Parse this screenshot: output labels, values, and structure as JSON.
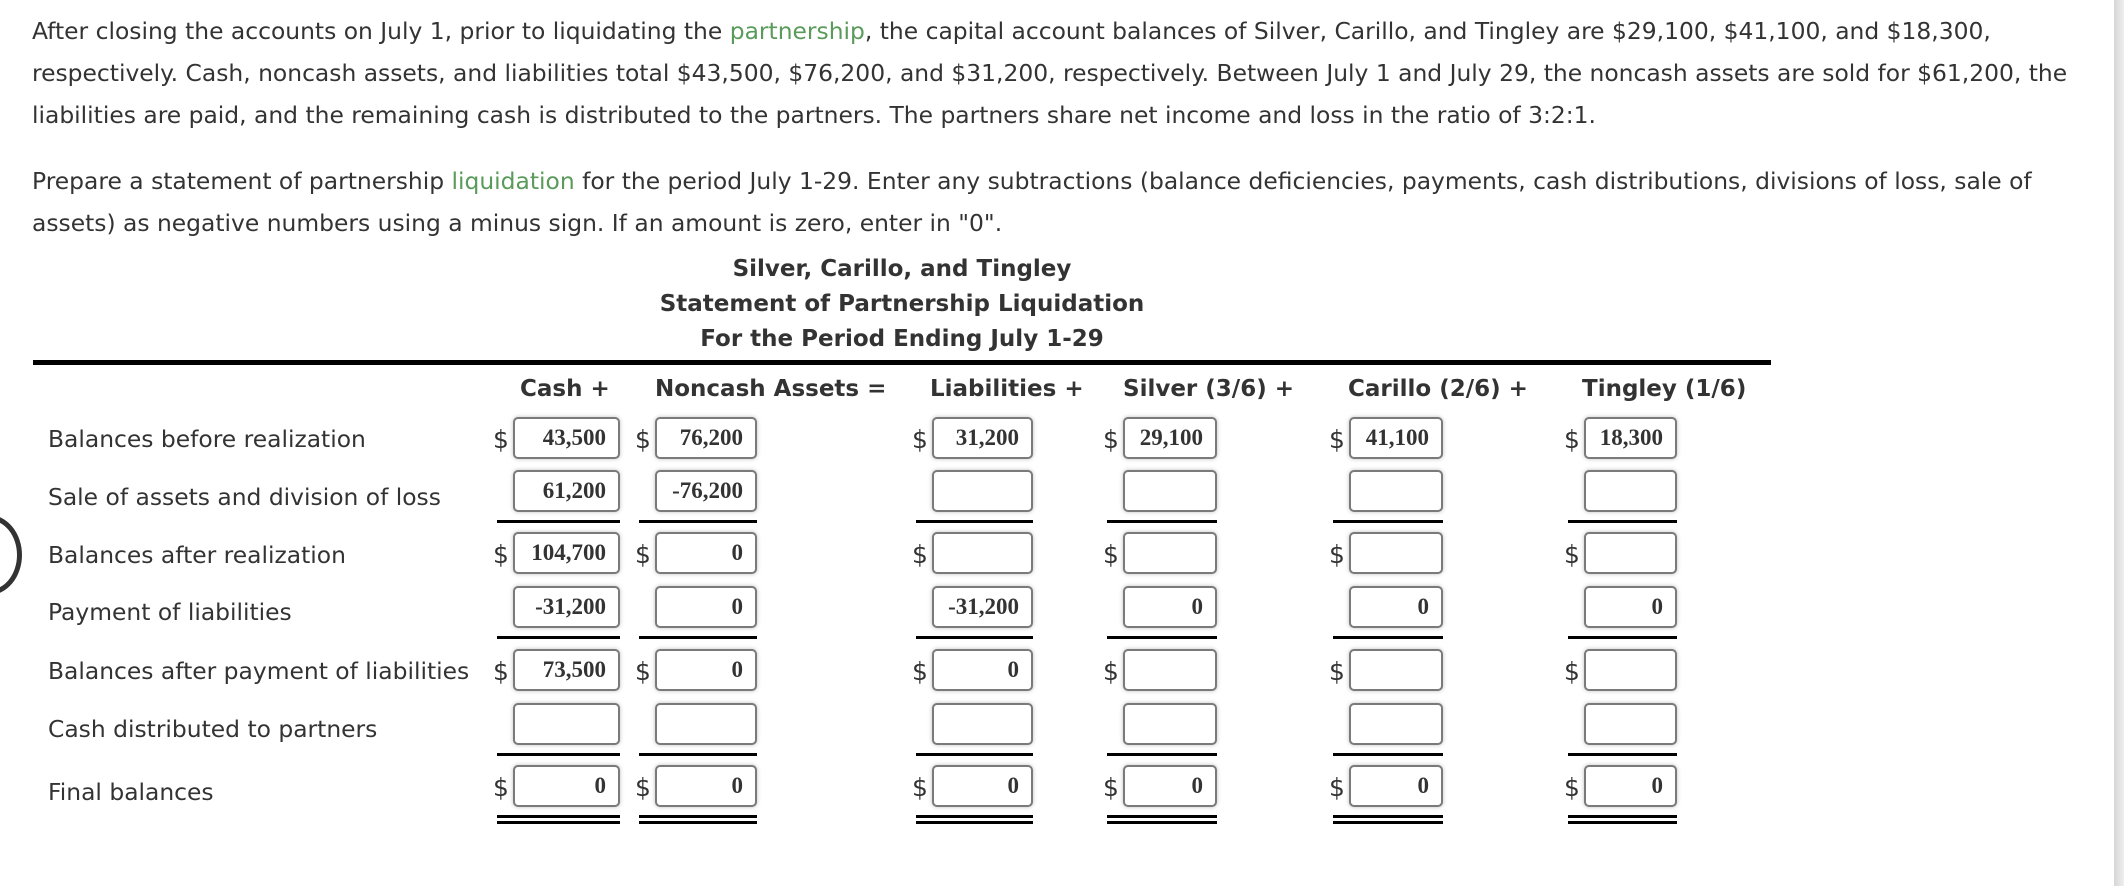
{
  "problem": {
    "p1_before_link1": "After closing the accounts on July 1, prior to liquidating the ",
    "p1_link1": "partnership",
    "p1_after_link1": ", the capital account balances of Silver, Carillo, and Tingley are $29,100, $41,100, and $18,300, respectively. Cash, noncash assets, and liabilities total $43,500, $76,200, and $31,200, respectively. Between July 1 and July 29, the noncash assets are sold for $61,200, the liabilities are paid, and the remaining cash is distributed to the partners. The partners share net income and loss in the ratio of 3:2:1.",
    "p2_before_link": "Prepare a statement of partnership ",
    "p2_link": "liquidation",
    "p2_after_link": " for the period July 1-29. Enter any subtractions (balance deficiencies, payments, cash distributions, divisions of loss, sale of assets) as negative numbers using a minus sign. If an amount is zero, enter in \"0\"."
  },
  "statement": {
    "company": "Silver, Carillo, and Tingley",
    "title": "Statement of Partnership Liquidation",
    "period": "For the Period Ending July 1-29"
  },
  "columns": [
    {
      "key": "cash",
      "label": "Cash +"
    },
    {
      "key": "noncash",
      "label": "Noncash Assets ="
    },
    {
      "key": "liabilities",
      "label": "Liabilities +"
    },
    {
      "key": "silver",
      "label": "Silver (3/6) +"
    },
    {
      "key": "carillo",
      "label": "Carillo (2/6) +"
    },
    {
      "key": "tingley",
      "label": "Tingley (1/6)"
    }
  ],
  "currency_symbol": "$",
  "rows": [
    {
      "label": "Balances before realization",
      "dollar": true,
      "values": [
        "43,500",
        "76,200",
        "31,200",
        "29,100",
        "41,100",
        "18,300"
      ]
    },
    {
      "label": "Sale of assets and division of loss",
      "dollar": false,
      "values": [
        "61,200",
        "-76,200",
        "",
        "",
        "",
        ""
      ]
    },
    {
      "label": "Balances after realization",
      "dollar": true,
      "values": [
        "104,700",
        "0",
        "",
        "",
        "",
        ""
      ]
    },
    {
      "label": "Payment of liabilities",
      "dollar": false,
      "values": [
        "-31,200",
        "0",
        "-31,200",
        "0",
        "0",
        "0"
      ]
    },
    {
      "label": "Balances after payment of liabilities",
      "dollar": true,
      "values": [
        "73,500",
        "0",
        "0",
        "",
        "",
        ""
      ]
    },
    {
      "label": "Cash distributed to partners",
      "dollar": false,
      "values": [
        "",
        "",
        "",
        "",
        "",
        ""
      ]
    },
    {
      "label": "Final balances",
      "dollar": true,
      "values": [
        "0",
        "0",
        "0",
        "0",
        "0",
        "0"
      ]
    }
  ],
  "colors": {
    "link": "#5a9a5a",
    "text": "#333333",
    "rule": "#000000"
  }
}
